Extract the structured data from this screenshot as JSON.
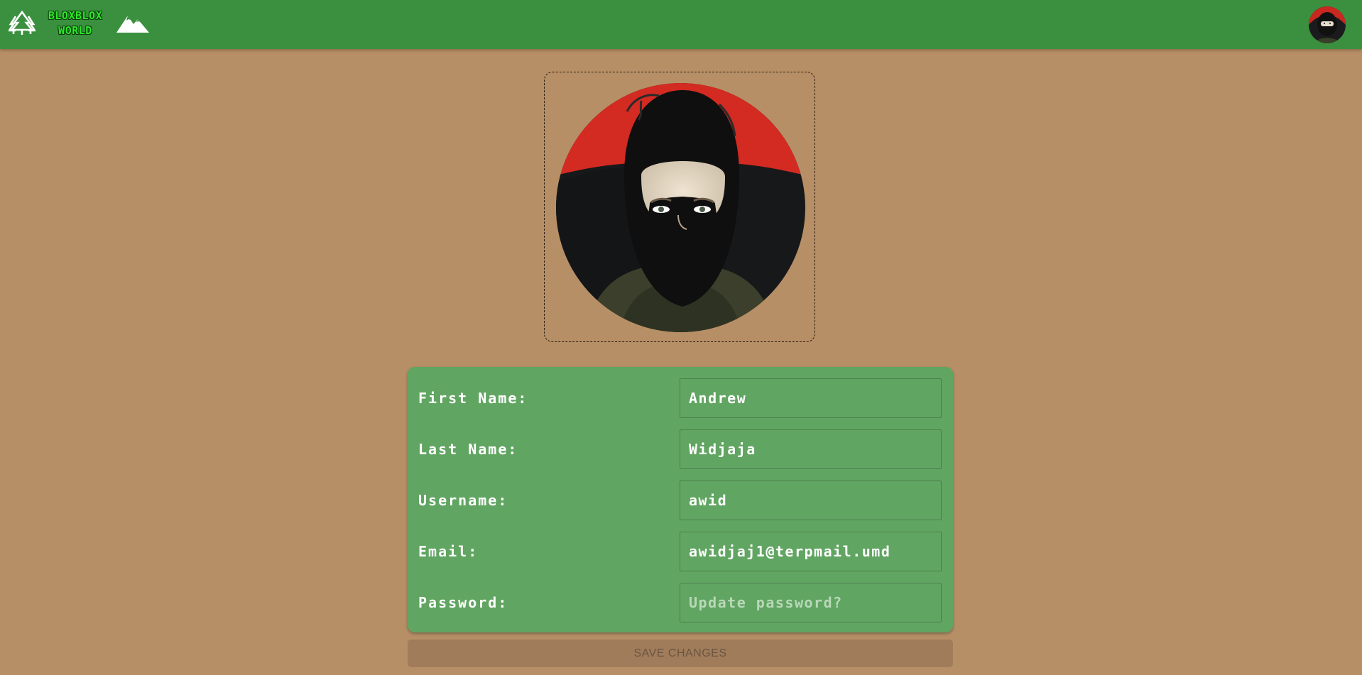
{
  "header": {
    "logo_line1": "BLOXBLOX",
    "logo_line2": "WORLD",
    "icons": [
      "tree-icon",
      "mountain-icon"
    ],
    "avatar": "profile-avatar"
  },
  "profile_photo": {
    "alt": "profile picture"
  },
  "form": {
    "fields": [
      {
        "label": "First Name:",
        "value": "Andrew",
        "placeholder": ""
      },
      {
        "label": "Last Name:",
        "value": "Widjaja",
        "placeholder": ""
      },
      {
        "label": "Username:",
        "value": "awid",
        "placeholder": ""
      },
      {
        "label": "Email:",
        "value": "awidjaj1@terpmail.umd",
        "placeholder": ""
      },
      {
        "label": "Password:",
        "value": "",
        "placeholder": "Update password?"
      }
    ],
    "save_label": "SAVE CHANGES"
  },
  "colors": {
    "background": "#b78f66",
    "header": "#3a903e",
    "logo": "#2ee62a",
    "card": "#61a562",
    "save_button": "#a07c5a"
  }
}
